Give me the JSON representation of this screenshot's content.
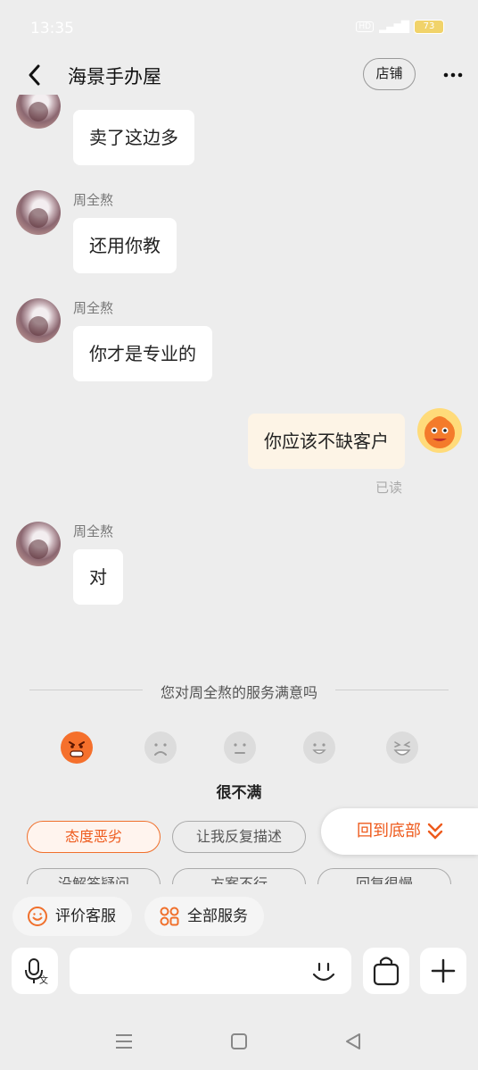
{
  "status": {
    "time": "13:35",
    "battery": "73",
    "network": "HD"
  },
  "header": {
    "title": "海景手办屋",
    "store_label": "店铺",
    "more_label": "···"
  },
  "messages": [
    {
      "side": "left",
      "sender": "",
      "text": "卖了这边多"
    },
    {
      "side": "left",
      "sender": "周全熬",
      "text": "还用你教"
    },
    {
      "side": "left",
      "sender": "周全熬",
      "text": "你才是专业的"
    },
    {
      "side": "right",
      "text": "你应该不缺客户",
      "status": "已读"
    },
    {
      "side": "left",
      "sender": "周全熬",
      "text": "对"
    }
  ],
  "survey": {
    "title": "您对周全熬的服务满意吗",
    "selected_rating": "很不满",
    "ratings": [
      "very-unsatisfied",
      "unsatisfied",
      "neutral",
      "satisfied",
      "very-satisfied"
    ],
    "chips_row1": [
      "态度恶劣",
      "让我反复描述"
    ],
    "chips_row2": [
      "没解答疑问",
      "方案不行",
      "回复很慢"
    ],
    "selected_chip": "态度恶劣"
  },
  "back_to_bottom": "回到底部",
  "actions": {
    "rate_service": "评价客服",
    "all_services": "全部服务"
  },
  "colors": {
    "accent": "#f0702c",
    "bubble_mine": "#fdf4e6",
    "background": "#ededed"
  }
}
